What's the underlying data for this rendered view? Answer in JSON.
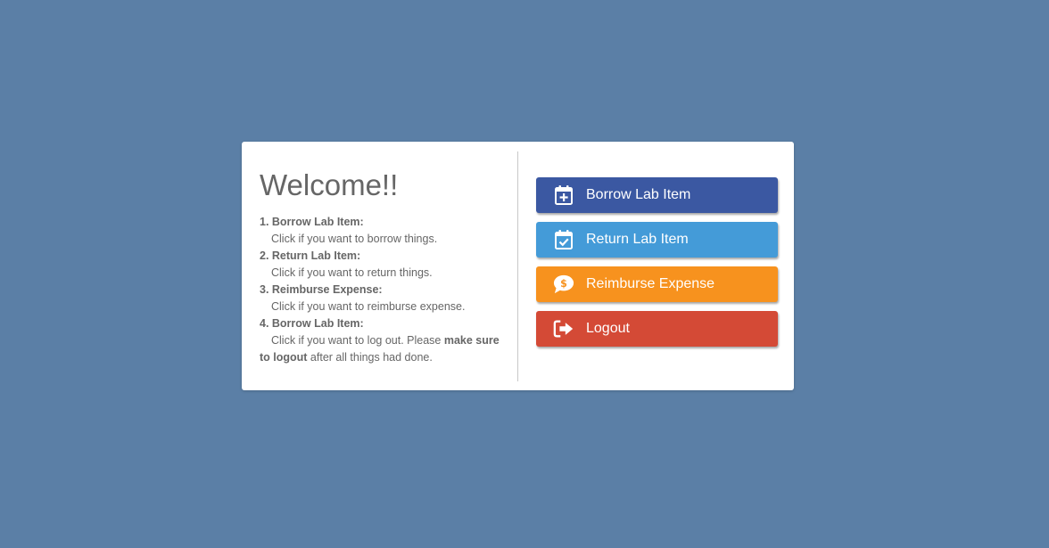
{
  "welcome": {
    "title": "Welcome!!",
    "items": [
      {
        "heading": "1. Borrow Lab Item:",
        "description": "Click if you want to borrow things."
      },
      {
        "heading": "2. Return Lab Item:",
        "description": "Click if you want to return things."
      },
      {
        "heading": "3. Reimburse Expense:",
        "description": "Click if you want to reimburse expense."
      },
      {
        "heading": "4. Borrow Lab Item:",
        "description_prefix": "Click if you want to log out. Please ",
        "description_bold": "make sure to logout",
        "description_suffix": " after all things had done."
      }
    ]
  },
  "buttons": {
    "borrow": {
      "label": "Borrow Lab Item",
      "icon": "calendar-plus-icon",
      "color": "#3b58a2"
    },
    "return": {
      "label": "Return Lab Item",
      "icon": "calendar-check-icon",
      "color": "#449bd8"
    },
    "reimburse": {
      "label": "Reimburse Expense",
      "icon": "dollar-chat-icon",
      "color": "#f7921e"
    },
    "logout": {
      "label": "Logout",
      "icon": "sign-out-icon",
      "color": "#d44a36"
    }
  },
  "colors": {
    "background": "#5b7fa6",
    "card": "#ffffff",
    "text": "#666666"
  }
}
